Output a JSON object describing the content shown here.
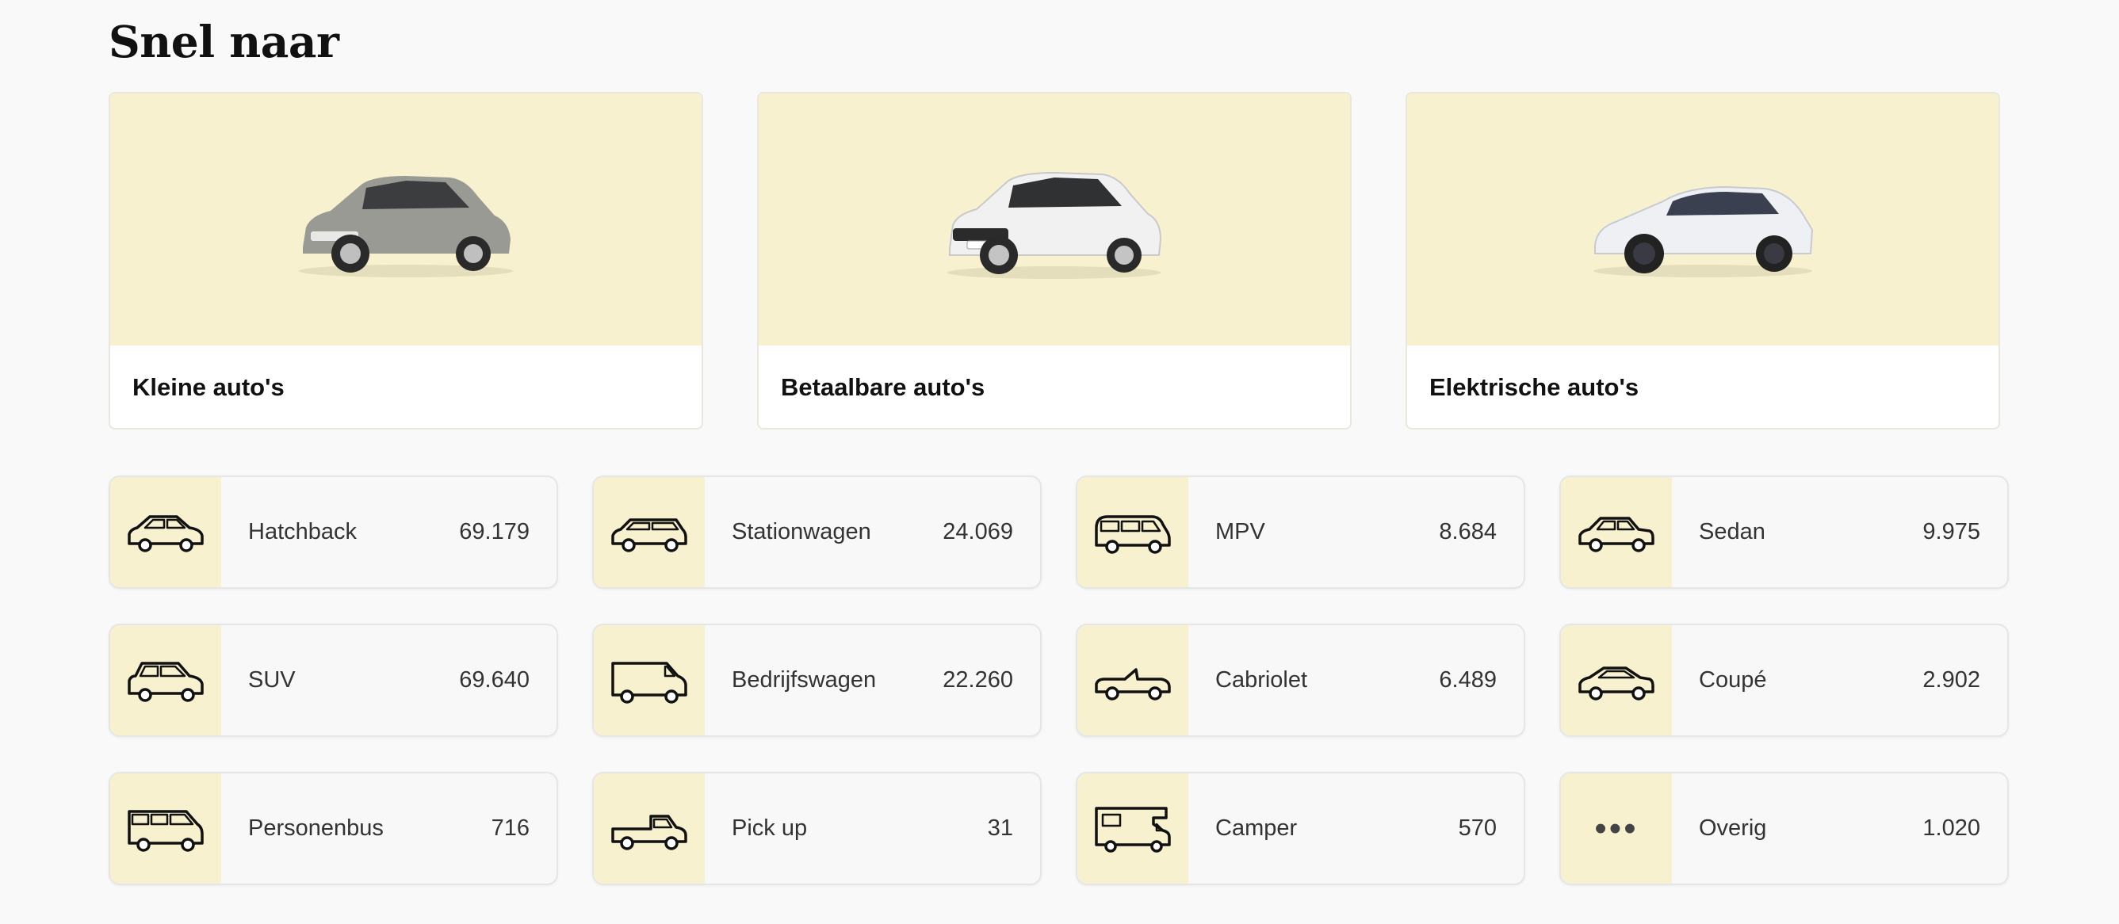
{
  "section": {
    "title": "Snel naar"
  },
  "quick_links": [
    {
      "label": "Kleine auto's",
      "image": "grey-hatchback-car"
    },
    {
      "label": "Betaalbare auto's",
      "image": "white-compact-car"
    },
    {
      "label": "Elektrische auto's",
      "image": "white-electric-suv"
    }
  ],
  "body_types": [
    {
      "label": "Hatchback",
      "count": "69.179",
      "icon": "hatchback-icon"
    },
    {
      "label": "Stationwagen",
      "count": "24.069",
      "icon": "stationwagen-icon"
    },
    {
      "label": "MPV",
      "count": "8.684",
      "icon": "mpv-icon"
    },
    {
      "label": "Sedan",
      "count": "9.975",
      "icon": "sedan-icon"
    },
    {
      "label": "SUV",
      "count": "69.640",
      "icon": "suv-icon"
    },
    {
      "label": "Bedrijfswagen",
      "count": "22.260",
      "icon": "van-icon"
    },
    {
      "label": "Cabriolet",
      "count": "6.489",
      "icon": "cabriolet-icon"
    },
    {
      "label": "Coupé",
      "count": "2.902",
      "icon": "coupe-icon"
    },
    {
      "label": "Personenbus",
      "count": "716",
      "icon": "minibus-icon"
    },
    {
      "label": "Pick up",
      "count": "31",
      "icon": "pickup-icon"
    },
    {
      "label": "Camper",
      "count": "570",
      "icon": "camper-icon"
    },
    {
      "label": "Overig",
      "count": "1.020",
      "icon": "more-icon"
    }
  ],
  "colors": {
    "accent_bg": "#f8f1cf",
    "page_bg": "#f9f9f9",
    "text": "#1b1b1b"
  }
}
